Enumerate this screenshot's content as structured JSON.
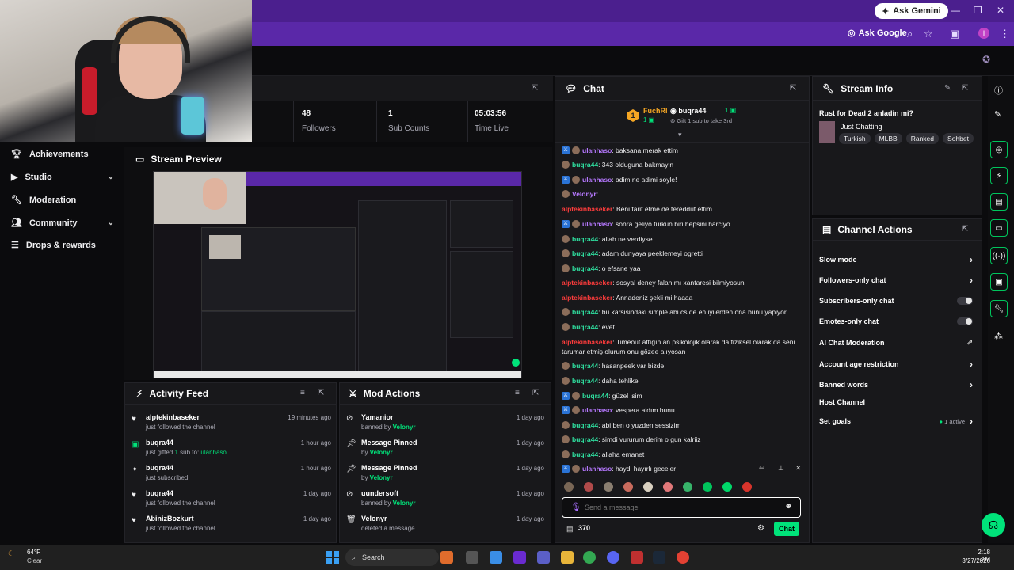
{
  "browser": {
    "gemini_label": "Ask Gemini",
    "google_label": "Ask Google",
    "profile_initial": "I"
  },
  "stats": [
    {
      "value": "48",
      "label": "Followers"
    },
    {
      "value": "1",
      "label": "Sub Counts"
    },
    {
      "value": "05:03:56",
      "label": "Time Live"
    }
  ],
  "nav": [
    {
      "label": "Achievements",
      "icon": "trophy-icon",
      "chevron": false
    },
    {
      "label": "Studio",
      "icon": "video-icon",
      "chevron": true
    },
    {
      "label": "Moderation",
      "icon": "wrench-icon",
      "chevron": false
    },
    {
      "label": "Community",
      "icon": "people-icon",
      "chevron": true
    },
    {
      "label": "Drops & rewards",
      "icon": "list-icon",
      "chevron": false
    }
  ],
  "preview": {
    "title": "Stream Preview"
  },
  "activity": {
    "title": "Activity Feed",
    "items": [
      {
        "name": "alptekinbaseker",
        "sub": "just followed the channel",
        "time": "19 minutes ago"
      },
      {
        "name": "buqra44",
        "sub_pre": "just gifted ",
        "sub_count": "1",
        "sub_mid": " sub to: ",
        "sub_target": "ulanhaso",
        "time": "1 hour ago"
      },
      {
        "name": "buqra44",
        "sub": "just subscribed",
        "time": "1 hour ago"
      },
      {
        "name": "buqra44",
        "sub": "just followed the channel",
        "time": "1 day ago"
      },
      {
        "name": "AbinizBozkurt",
        "sub": "just followed the channel",
        "time": "1 day ago"
      }
    ]
  },
  "mod": {
    "title": "Mod Actions",
    "items": [
      {
        "name": "Yamanior",
        "sub_pre": "banned by ",
        "by": "Velonyr",
        "time": "1 day ago"
      },
      {
        "name": "Message Pinned",
        "sub_pre": "by ",
        "by": "Velonyr",
        "time": "1 day ago"
      },
      {
        "name": "Message Pinned",
        "sub_pre": "by ",
        "by": "Velonyr",
        "time": "1 day ago"
      },
      {
        "name": "uundersoft",
        "sub_pre": "banned by ",
        "by": "Velonyr",
        "time": "1 day ago"
      },
      {
        "name": "Velonyr",
        "sub_pre": "deleted a message",
        "by": "",
        "time": "1 day ago"
      }
    ]
  },
  "chat": {
    "title": "Chat",
    "top_gifter_1": "FuchRI",
    "top_gifter_1_count": "1",
    "top_gifter_2": "buqra44",
    "top_gifter_2_count": "1",
    "gift_hint": "Gift 1 sub to take 3rd",
    "placeholder": "Send a message",
    "points": "370",
    "send_label": "Chat",
    "messages": [
      {
        "user": "ulanhaso",
        "color": "purple",
        "text": ": baksana merak ettim",
        "tw": true
      },
      {
        "user": "buqra44",
        "color": "green",
        "text": ": 343 olduguna bakmayin",
        "tw": false
      },
      {
        "user": "ulanhaso",
        "color": "purple",
        "text": ": adim ne adimi soyle!",
        "tw": true
      },
      {
        "user": "Velonyr",
        "color": "purple",
        "text": ":",
        "tw": false
      },
      {
        "user": "alptekinbaseker",
        "color": "red",
        "text": ": Beni tarif etme de tereddüt ettim",
        "tw": false
      },
      {
        "user": "ulanhaso",
        "color": "purple",
        "text": ": sonra geliyo turkun biri hepsini harciyo",
        "tw": true
      },
      {
        "user": "buqra44",
        "color": "green",
        "text": ": allah ne verdiyse",
        "tw": false
      },
      {
        "user": "buqra44",
        "color": "green",
        "text": ": adam dunyaya peeklemeyi ogretti",
        "tw": false
      },
      {
        "user": "buqra44",
        "color": "green",
        "text": ": o efsane yaa",
        "tw": false
      },
      {
        "user": "alptekinbaseker",
        "color": "red",
        "text": ": sosyal deney falan mı xantaresi bilmiyosun",
        "tw": false
      },
      {
        "user": "alptekinbaseker",
        "color": "red",
        "text": ": Annadeniz şekli mi haaaa",
        "tw": false
      },
      {
        "user": "buqra44",
        "color": "green",
        "text": ": bu karsisindaki simple abi cs de en iyilerden ona bunu yapiyor",
        "tw": false
      },
      {
        "user": "buqra44",
        "color": "green",
        "text": ": evet",
        "tw": false
      },
      {
        "user": "alptekinbaseker",
        "color": "red",
        "text": ": Timeout attığın an psikolojik olarak da fiziksel olarak da seni tarumar etmiş olurum onu gözee alıyosan",
        "tw": false
      },
      {
        "user": "buqra44",
        "color": "green",
        "text": ": hasanpeek var bizde",
        "tw": false
      },
      {
        "user": "buqra44",
        "color": "green",
        "text": ": daha tehlike",
        "tw": false
      },
      {
        "user": "buqra44",
        "color": "green",
        "text": ": güzel isim",
        "tw": true
      },
      {
        "user": "ulanhaso",
        "color": "purple",
        "text": ": vespera aldım bunu",
        "tw": true
      },
      {
        "user": "buqra44",
        "color": "green",
        "text": ": abi ben o yuzden sessizim",
        "tw": false
      },
      {
        "user": "buqra44",
        "color": "green",
        "text": ": simdi vururum derim o gun kalriiz",
        "tw": false
      },
      {
        "user": "buqra44",
        "color": "green",
        "text": ": allaha emanet",
        "tw": false
      },
      {
        "user": "ulanhaso",
        "color": "purple",
        "text": ": haydi hayırlı geceler",
        "tw": true
      }
    ]
  },
  "stream_info": {
    "title": "Stream Info",
    "stream_title": "Rust for Dead 2 anladin mi?",
    "category": "Just Chatting",
    "tags": [
      "Turkish",
      "MLBB",
      "Ranked",
      "Sohbet"
    ]
  },
  "channel_actions": {
    "title": "Channel Actions",
    "items": [
      {
        "label": "Slow mode",
        "control": "chevron"
      },
      {
        "label": "Followers-only chat",
        "control": "chevron"
      },
      {
        "label": "Subscribers-only chat",
        "control": "toggle"
      },
      {
        "label": "Emotes-only chat",
        "control": "toggle"
      },
      {
        "label": "AI Chat Moderation",
        "control": "external"
      },
      {
        "label": "Account age restriction",
        "control": "chevron"
      },
      {
        "label": "Banned words",
        "control": "chevron"
      },
      {
        "label": "Host Channel",
        "control": "none"
      },
      {
        "label": "Set goals",
        "control": "chevron"
      }
    ],
    "goals_status": "1 active"
  },
  "taskbar": {
    "weather_temp": "64°F",
    "weather_desc": "Clear",
    "search_label": "Search",
    "time": "2:18 AM",
    "date": "3/27/2026"
  },
  "colors": {
    "accent": "#00e37a",
    "brand": "#5a28a8",
    "panel": "#18181b"
  }
}
